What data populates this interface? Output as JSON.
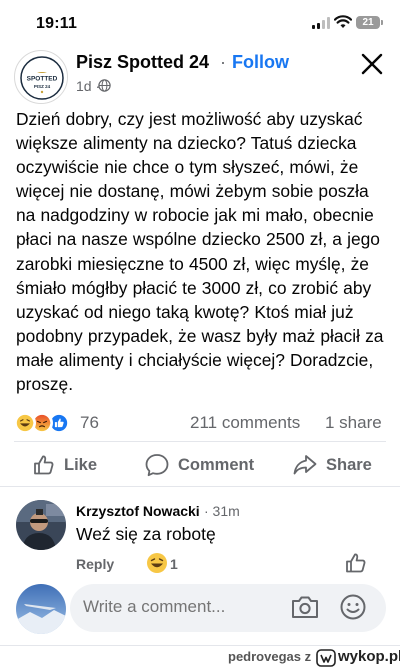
{
  "status_bar": {
    "time": "19:11",
    "battery": "21"
  },
  "post": {
    "page_name": "Pisz Spotted 24",
    "separator": "·",
    "follow_label": "Follow",
    "time_ago": "1d ·",
    "logo_text_top": "SPOTTED",
    "logo_text_bottom": "PISZ 24",
    "text": "Dzień dobry, czy jest możliwość aby uzyskać większe alimenty na dziecko? Tatuś dziecka oczywiście nie chce o tym słyszeć, mówi, że więcej nie dostanę, mówi żebym sobie poszła na nadgodziny w robocie jak mi mało, obecnie płaci na nasze wspólne dziecko 2500 zł, a jego zarobki miesięczne to 4500 zł,  więc myślę, że śmiało mógłby płacić te 3000 zł, co zrobić aby uzyskać od niego taką kwotę? Ktoś miał już podobny przypadek, że wasz były maż płacił za małe alimenty i chciałyście więcej? Doradzcie, proszę.",
    "reaction_count": "76",
    "comments_count": "211 comments",
    "shares_count": "1 share",
    "reaction_icons": [
      "laugh-reaction-icon",
      "angry-reaction-icon",
      "like-reaction-icon"
    ]
  },
  "actions": {
    "like": "Like",
    "comment": "Comment",
    "share": "Share"
  },
  "comment": {
    "author": "Krzysztof Nowacki",
    "time": "· 31m",
    "text": "Weź się za robotę",
    "reply_label": "Reply",
    "reaction_count": "1"
  },
  "composer": {
    "placeholder": "Write a comment..."
  },
  "footer": {
    "user": "pedrovegas  z",
    "site": "wykop.pl"
  },
  "colors": {
    "accent": "#1877f2",
    "secondary_text": "#65676b",
    "divider": "#e4e6eb"
  }
}
